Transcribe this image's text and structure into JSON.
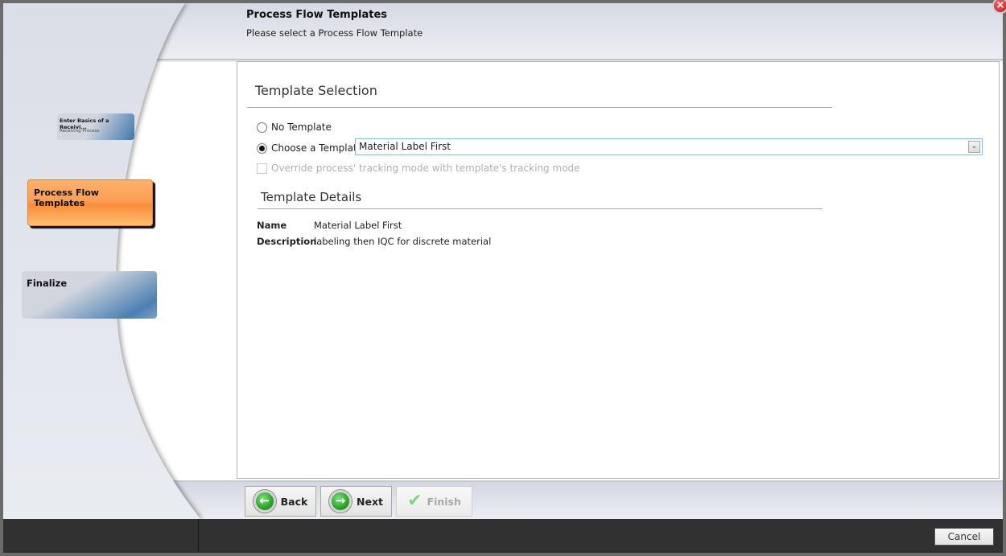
{
  "header": {
    "title": "Process Flow Templates",
    "subtitle": "Please select a Process Flow Template"
  },
  "steps": [
    {
      "title": "Enter Basics of a Receivi...",
      "subtitle": "Receiving Process",
      "state": "completed"
    },
    {
      "title": "Process Flow Templates",
      "subtitle": "",
      "state": "active"
    },
    {
      "title": "Finalize",
      "subtitle": "",
      "state": "pending"
    }
  ],
  "template_selection": {
    "section_title": "Template Selection",
    "no_template_label": "No Template",
    "choose_template_label": "Choose a Template",
    "selected_option": "no_template_false",
    "template_value": "Material Label First",
    "override_label": "Override process' tracking mode with template's tracking mode",
    "override_checked": false,
    "override_enabled": false
  },
  "template_details": {
    "section_title": "Template Details",
    "name_label": "Name",
    "name_value": "Material Label First",
    "description_label": "Description",
    "description_value": "labeling then IQC for discrete material"
  },
  "nav": {
    "back_label": "Back",
    "next_label": "Next",
    "finish_label": "Finish",
    "finish_enabled": false
  },
  "cancel_label": "Cancel",
  "icons": {
    "close": "close-icon",
    "back": "arrow-left-icon",
    "next": "arrow-right-icon",
    "finish": "checkmark-icon",
    "dropdown": "chevron-down-icon"
  }
}
